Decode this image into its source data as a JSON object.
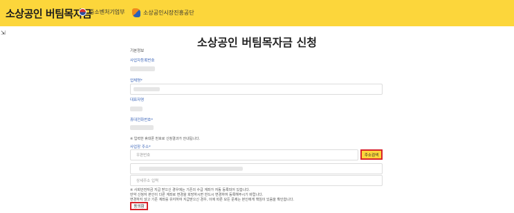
{
  "header": {
    "brand": "소상공인 버팀목자금",
    "orgs": [
      "중소벤처기업부",
      "소상공인시장진흥공단"
    ]
  },
  "page_title": "소상공인 버팀목자금 신청",
  "form": {
    "section_label": "기본정보",
    "business_number_label": "사업자등록번호",
    "company_name_label": "업체명*",
    "representative_label": "대표자명",
    "mobile_label": "휴대전화번호*",
    "mobile_note": "※ 입력한 휴대폰 번호로 신청결과가 안내됩니다.",
    "address_label": "사업장 주소*",
    "postcode_placeholder": "우편번호",
    "address_search_button": "주소검색",
    "detail_address_placeholder": "상세주소 입력",
    "notices": [
      "※ 사회안전자금 지급 받으신 경우에는 기존의 수급 계좌가 자동 등록되어 있습니다.",
      "만약 신청자 본인이 다른 계좌로 변경을 희망하시면 반드시 변경하여 등록해주시기 바랍니다.",
      "변경하지 않고 기존 계좌를 유지하여 지급받으신 경우, 이에 따른 모든 문제는 본인에게 책임이 있음을 확인합니다."
    ],
    "agree_button": "동의함"
  },
  "colors": {
    "header_bg": "#fcd63b",
    "label_blue": "#3a64b8",
    "highlight_red": "#d8232a"
  }
}
